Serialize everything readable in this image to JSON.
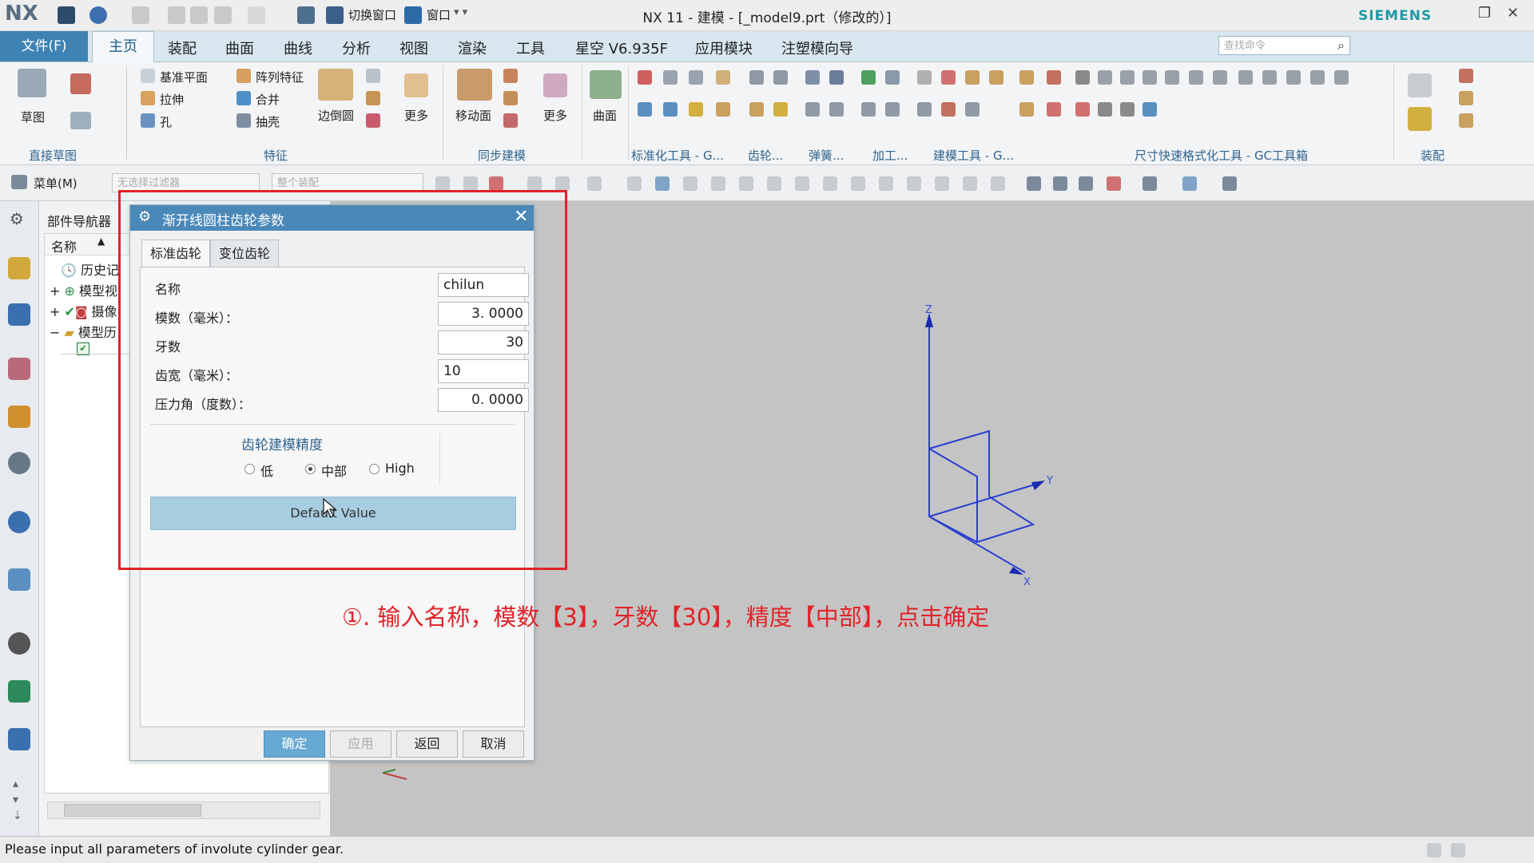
{
  "titlebar": {
    "logo": "NX",
    "quick_items": [
      "切换窗口",
      "窗口"
    ],
    "title": "NX 11 - 建模 - [_model9.prt（修改的）]",
    "brand": "SIEMENS"
  },
  "ribbon_tabs": {
    "file": "文件(F)",
    "tabs": [
      "主页",
      "装配",
      "曲面",
      "曲线",
      "分析",
      "视图",
      "渲染",
      "工具",
      "星空 V6.935F",
      "应用模块",
      "注塑模向导"
    ],
    "search_placeholder": "查找命令"
  },
  "ribbon": {
    "groups": [
      "直接草图",
      "特征",
      "同步建模",
      "标准化工具 - G...",
      "齿轮...",
      "弹簧...",
      "加工...",
      "建模工具 - G...",
      "尺寸快速格式化工具 - GC工具箱",
      "装配"
    ],
    "sketch": "草图",
    "feature_items": [
      "基准平面",
      "阵列特征",
      "拉伸",
      "合并",
      "孔",
      "抽壳",
      "边倒圆",
      "更多"
    ],
    "sync_items": [
      "移动面",
      "更多"
    ],
    "surface": "曲面"
  },
  "toolbar": {
    "menu": "菜单(M)",
    "filter_placeholder": "无选择过滤器",
    "scope_placeholder": "整个装配"
  },
  "navigator": {
    "title": "部件导航器",
    "column": "名称",
    "rows": [
      "历史记",
      "模型视",
      "摄像",
      "模型历"
    ]
  },
  "dialog": {
    "title": "渐开线圆柱齿轮参数",
    "tabs": [
      "标准齿轮",
      "变位齿轮"
    ],
    "fields": [
      {
        "label": "名称",
        "value": "chilun"
      },
      {
        "label": "模数（毫米）：",
        "value": "3. 0000"
      },
      {
        "label": "牙数",
        "value": "30"
      },
      {
        "label": "齿宽（毫米）：",
        "value": "10"
      },
      {
        "label": "压力角（度数）：",
        "value": "0. 0000"
      }
    ],
    "precision_title": "齿轮建模精度",
    "precision_options": [
      "低",
      "中部",
      "High"
    ],
    "precision_selected": "中部",
    "default_button": "Default Value",
    "buttons": {
      "ok": "确定",
      "apply": "应用",
      "back": "返回",
      "cancel": "取消"
    }
  },
  "axes": {
    "x": "X",
    "y": "Y",
    "z": "Z"
  },
  "annotation": "①. 输入名称，模数【3】，牙数【30】，精度【中部】，点击确定",
  "statusbar": {
    "message": "Please input all parameters of involute cylinder gear."
  },
  "colors": {
    "accent": "#3f83b4",
    "highlight_red": "#e0242a",
    "dialog_title": "#4a88b8"
  }
}
